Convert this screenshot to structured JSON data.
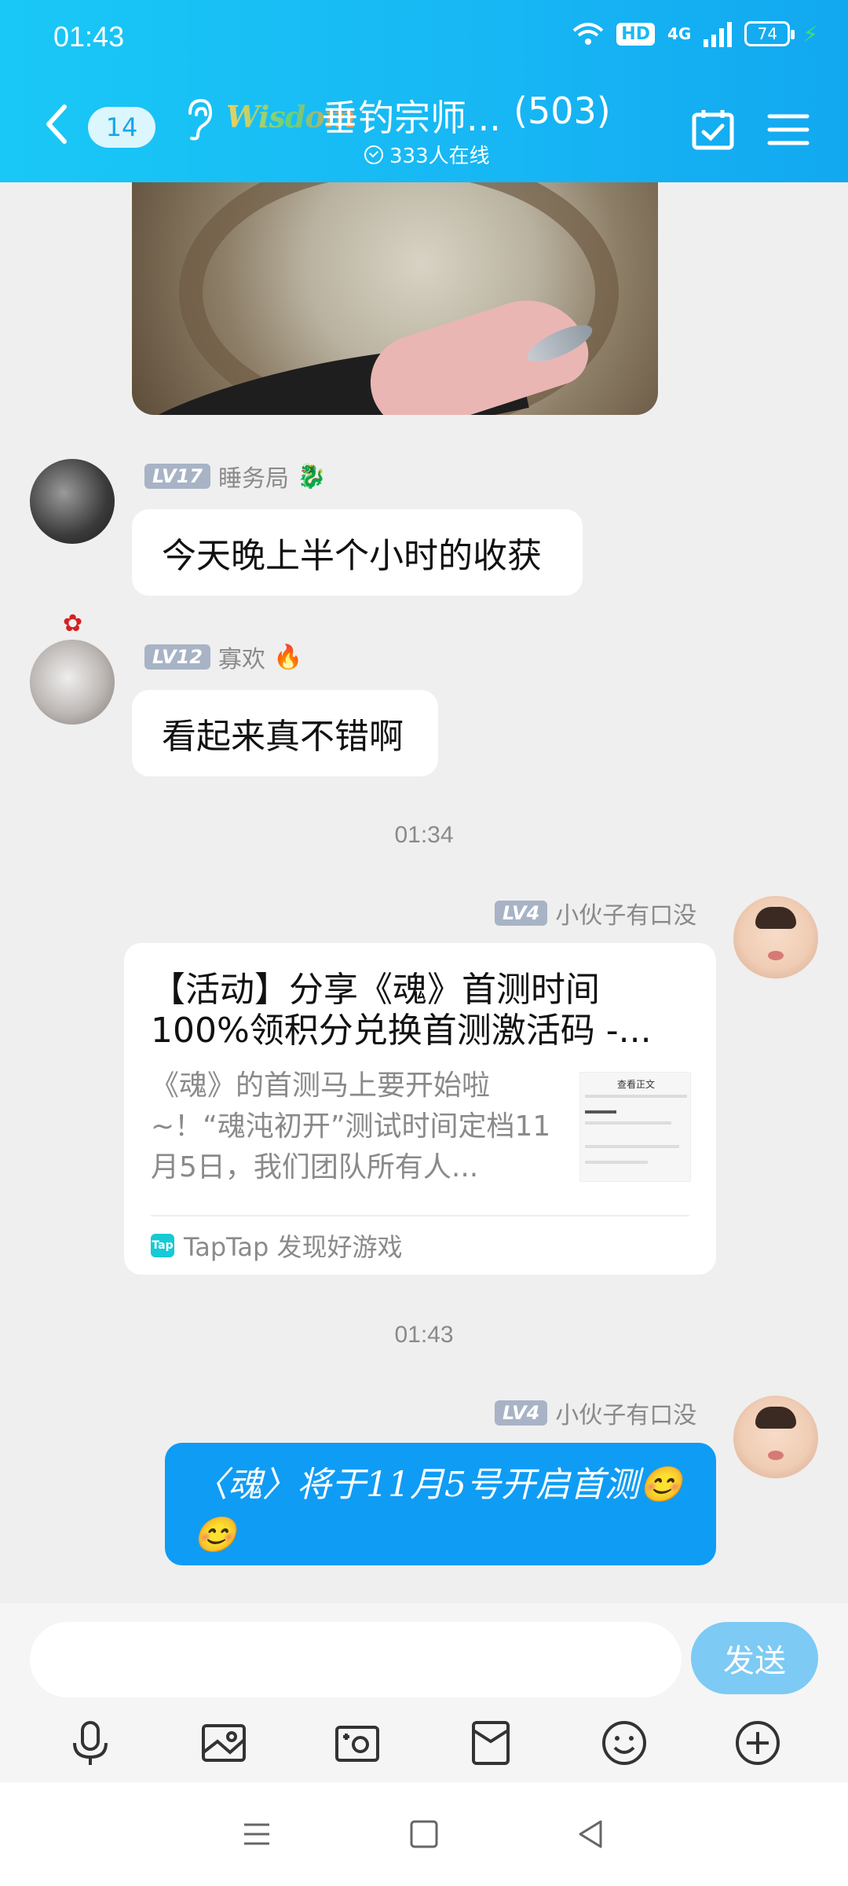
{
  "status_bar": {
    "time": "01:43",
    "hd": "HD",
    "network": "4G",
    "battery": "74"
  },
  "header": {
    "unread_count": "14",
    "logo_text": "Wisdom",
    "group_name": "垂钓宗师...",
    "member_count": "(503)",
    "online_text": "333人在线"
  },
  "messages": [
    {
      "level": "LV17",
      "sender": "睡务局",
      "badge": "🐉",
      "text": "今天晚上半个小时的收获"
    },
    {
      "level": "LV12",
      "sender": "寡欢",
      "badge": "🔥",
      "text": "看起来真不错啊"
    },
    {
      "level": "LV4",
      "sender": "小伙子有口没"
    },
    {
      "level": "LV4",
      "sender": "小伙子有口没",
      "text": "〈魂〉将于11月5号开启首测😊😊"
    }
  ],
  "timestamps": [
    "01:34",
    "01:43"
  ],
  "share_card": {
    "title": "【活动】分享《魂》首测时间100%领积分兑换首测激活码 -...",
    "description": "《魂》的首测马上要开始啦~！“魂沌初开”测试时间定档11月5日，我们团队所有人...",
    "thumb_title": "查看正文",
    "source_icon": "Tap",
    "source": "TapTap 发现好游戏"
  },
  "input": {
    "placeholder": "",
    "send_label": "发送"
  },
  "toolbar_icons": [
    "microphone-icon",
    "image-icon",
    "camera-icon",
    "red-packet-icon",
    "emoji-icon",
    "plus-icon"
  ],
  "colors": {
    "header": "#17b6f4",
    "blue_bubble": "#0f9cf5",
    "send_button": "#7dcaf5"
  }
}
